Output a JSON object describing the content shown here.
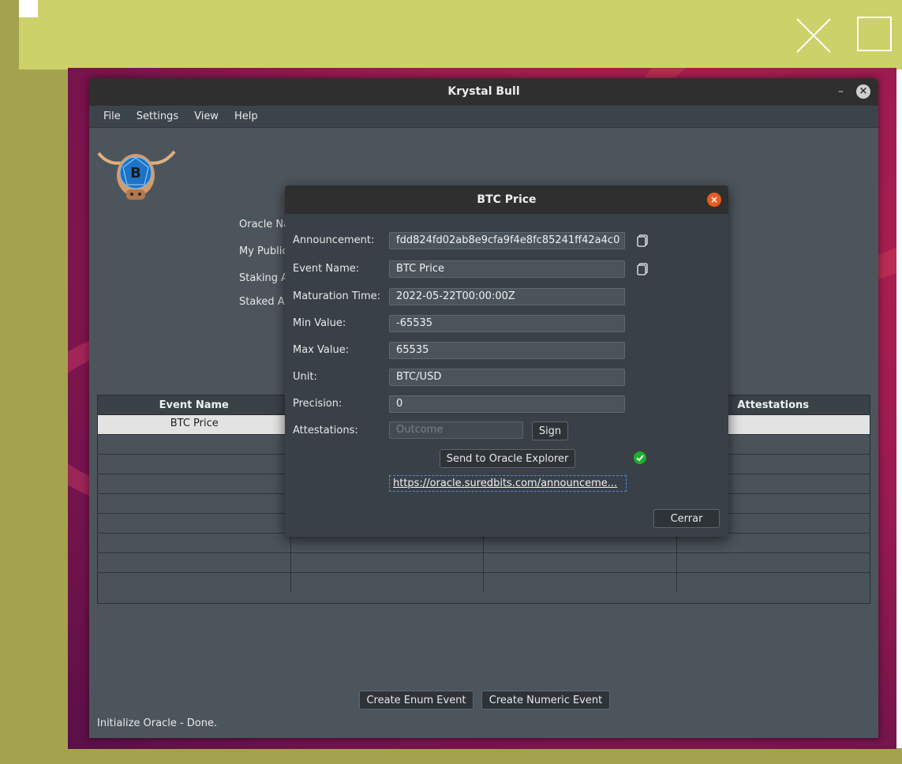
{
  "app": {
    "title": "Krystal Bull",
    "minimize": "–",
    "close": "×"
  },
  "menu": [
    "File",
    "Settings",
    "View",
    "Help"
  ],
  "form_labels": [
    "Oracle Na",
    "My Public",
    "Staking A",
    "Staked A"
  ],
  "table": {
    "headers": [
      "Event Name",
      "",
      "",
      "Attestations"
    ],
    "rows": [
      [
        "BTC Price",
        "",
        "",
        ""
      ]
    ]
  },
  "buttons": {
    "create_enum": "Create Enum Event",
    "create_numeric": "Create Numeric Event"
  },
  "status": "Initialize Oracle - Done.",
  "dialog": {
    "title": "BTC Price",
    "fields": [
      {
        "label": "Announcement:",
        "value": "fdd824fd02ab8e9cfa9f4e8fc85241ff42a4c0"
      },
      {
        "label": "Event Name:",
        "value": "BTC Price"
      },
      {
        "label": "Maturation Time:",
        "value": "2022-05-22T00:00:00Z"
      },
      {
        "label": "Min Value:",
        "value": "-65535"
      },
      {
        "label": "Max Value:",
        "value": "65535"
      },
      {
        "label": "Unit:",
        "value": "BTC/USD"
      },
      {
        "label": "Precision:",
        "value": "0"
      }
    ],
    "attestations_label": "Attestations:",
    "outcome_placeholder": "Outcome",
    "sign": "Sign",
    "send": "Send to Oracle Explorer",
    "link": "https://oracle.suredbits.com/announceme...",
    "close": "Cerrar"
  },
  "colors": {
    "banner": "#cdd16a",
    "backdrop": "#a4a24f",
    "dialog_close": "#e85a1e",
    "check": "#1fae2b"
  }
}
